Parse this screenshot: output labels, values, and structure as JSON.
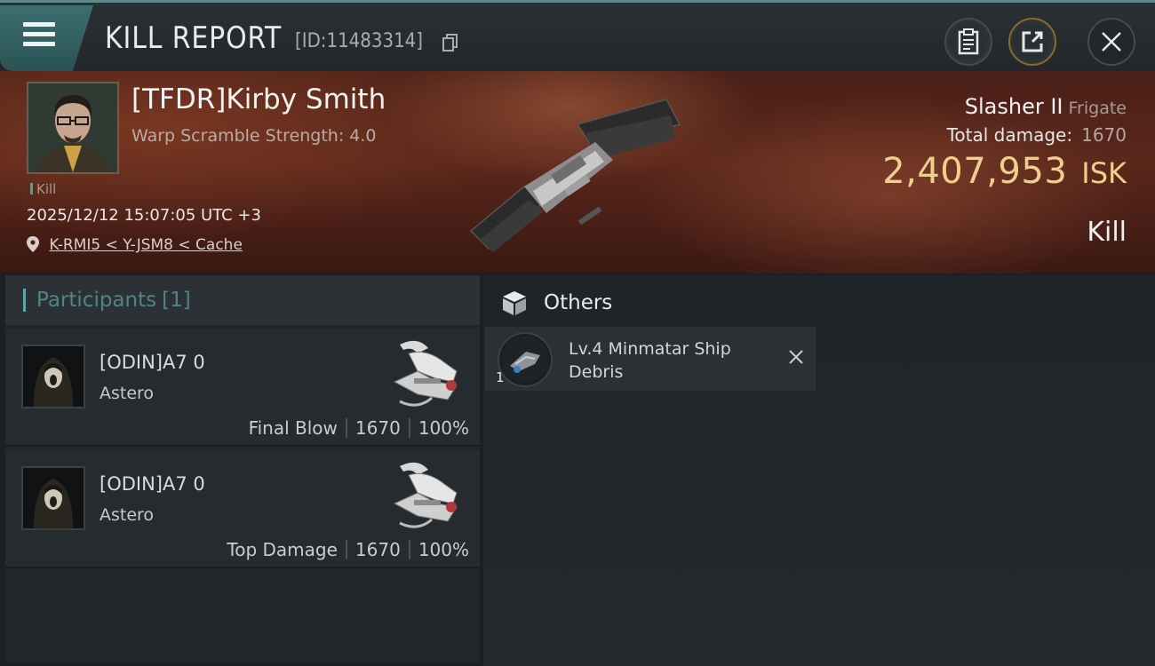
{
  "header": {
    "title": "KILL REPORT",
    "report_id": "[ID:11483314]"
  },
  "victim": {
    "name": "[TFDR]Kirby Smith",
    "subtitle": "Warp Scramble Strength: 4.0",
    "kill_count": "Kill",
    "datetime": "2025/12/12 15:07:05 UTC +3",
    "location": "K-RMI5 < Y-JSM8 < Cache",
    "ship_name": "Slasher II",
    "ship_class": "Frigate",
    "total_damage_label": "Total damage:",
    "total_damage": "1670",
    "isk_value": "2,407,953",
    "isk_unit": "ISK",
    "kill_type": "Kill"
  },
  "participants": {
    "label": "Participants",
    "count": "[1]",
    "rows": [
      {
        "name": "[ODIN]A7 0",
        "ship": "Astero",
        "role": "Final Blow",
        "damage": "1670",
        "percent": "100%"
      },
      {
        "name": "[ODIN]A7 0",
        "ship": "Astero",
        "role": "Top Damage",
        "damage": "1670",
        "percent": "100%"
      }
    ]
  },
  "others": {
    "label": "Others",
    "items": [
      {
        "name": "Lv.4 Minmatar Ship Debris",
        "qty": "1"
      }
    ]
  },
  "colors": {
    "accent": "#5fa6a7",
    "isk": "#efcf8e",
    "banner": "#5a271b"
  }
}
